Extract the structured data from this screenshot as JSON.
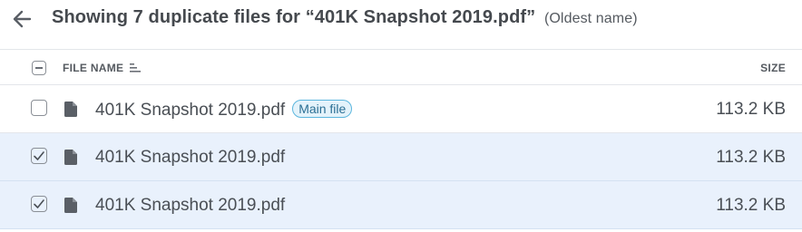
{
  "header": {
    "back_icon": "arrow-left-icon",
    "title": "Showing 7 duplicate files for “401K Snapshot 2019.pdf”",
    "subtitle": "(Oldest name)"
  },
  "table": {
    "columns": {
      "name": "FILE NAME",
      "size": "SIZE"
    },
    "sort_icon": "sort-lines-icon",
    "rows": [
      {
        "name": "401K Snapshot 2019.pdf",
        "badge": "Main file",
        "size": "113.2 KB",
        "checked": false
      },
      {
        "name": "401K Snapshot 2019.pdf",
        "badge": "",
        "size": "113.2 KB",
        "checked": true
      },
      {
        "name": "401K Snapshot 2019.pdf",
        "badge": "",
        "size": "113.2 KB",
        "checked": true
      }
    ]
  },
  "colors": {
    "selected_row": "#e9f1fc",
    "badge_border": "#5bb6de",
    "badge_bg": "#e4f3fb"
  }
}
